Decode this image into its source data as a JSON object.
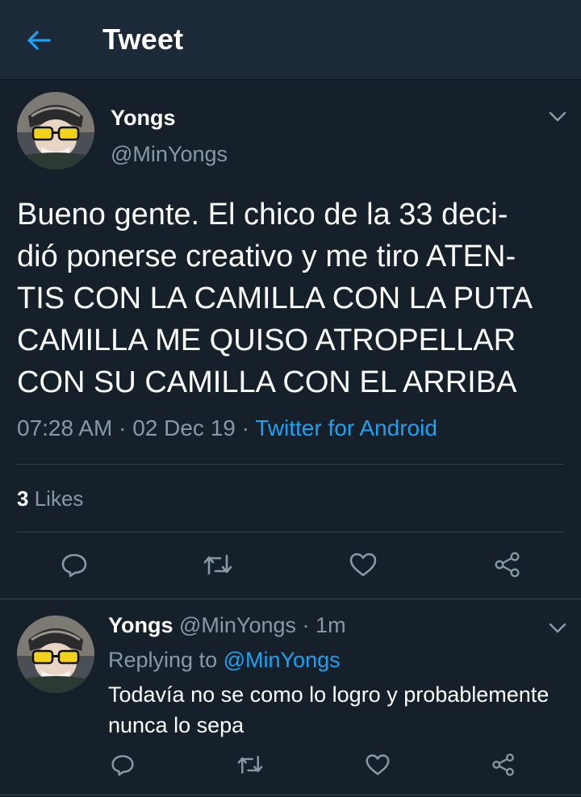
{
  "header": {
    "title": "Tweet",
    "back_icon": "arrow-left-icon"
  },
  "tweet": {
    "author_name": "Yongs",
    "author_handle": "@MinYongs",
    "text": "Bueno gente. El chico de la 33 deci-\ndió ponerse creativo y me tiro ATEN-\nTIS CON LA CAMILLA CON LA PUTA\nCAMILLA ME QUISO ATROPELLAR\nCON SU CAMILLA CON EL ARRIBA",
    "time": "07:28 AM",
    "date": "02 Dec 19",
    "separator": "·",
    "source": "Twitter for Android",
    "likes_count": "3",
    "likes_label": "Likes",
    "actions": [
      "reply-icon",
      "retweet-icon",
      "like-icon",
      "share-icon"
    ]
  },
  "reply": {
    "author_name": "Yongs",
    "author_handle": "@MinYongs",
    "separator": "·",
    "time_ago": "1m",
    "replying_label": "Replying to",
    "replying_to": "@MinYongs",
    "text": "Todavía no se como lo logro y probablemente nunca lo sepa"
  },
  "colors": {
    "background": "#15202b",
    "header_bg": "#1c2938",
    "accent": "#1da1f2",
    "secondary_text": "#8899a6",
    "divider": "#38444d"
  }
}
